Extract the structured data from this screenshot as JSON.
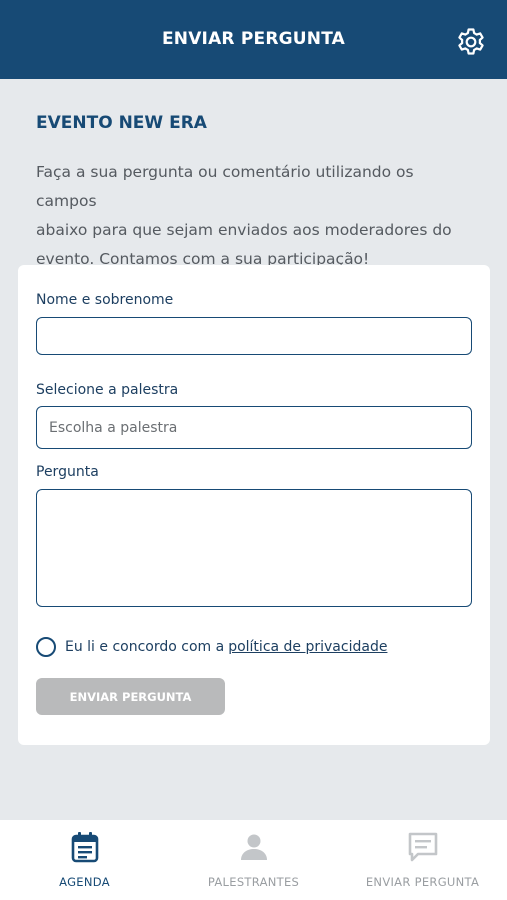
{
  "header": {
    "title": "ENVIAR PERGUNTA",
    "settings_icon": "gear-icon"
  },
  "event": {
    "title": "EVENTO NEW ERA",
    "intro_lines": [
      "Faça a sua pergunta ou comentário utilizando os campos",
      "abaixo para que sejam enviados aos moderadores do",
      "evento. Contamos com a sua participação!"
    ]
  },
  "form": {
    "name_label": "Nome e sobrenome",
    "name_value": "",
    "talk_label": "Selecione a palestra",
    "talk_placeholder": "Escolha a palestra",
    "question_label": "Pergunta",
    "question_value": "",
    "consent_text": "Eu li e concordo com a",
    "consent_link": "política de privacidade",
    "submit_label": "ENVIAR PERGUNTA"
  },
  "tabs": [
    {
      "label": "AGENDA",
      "icon": "agenda-icon",
      "active": true
    },
    {
      "label": "PALESTRANTES",
      "icon": "person-icon",
      "active": false
    },
    {
      "label": "ENVIAR PERGUNTA",
      "icon": "message-icon",
      "active": false
    }
  ],
  "colors": {
    "header_bg": "#174a75",
    "accent": "#174a75",
    "background": "#e6e9ec",
    "disabled_button": "#b9babb",
    "inactive_tab": "#c3c6c9"
  }
}
